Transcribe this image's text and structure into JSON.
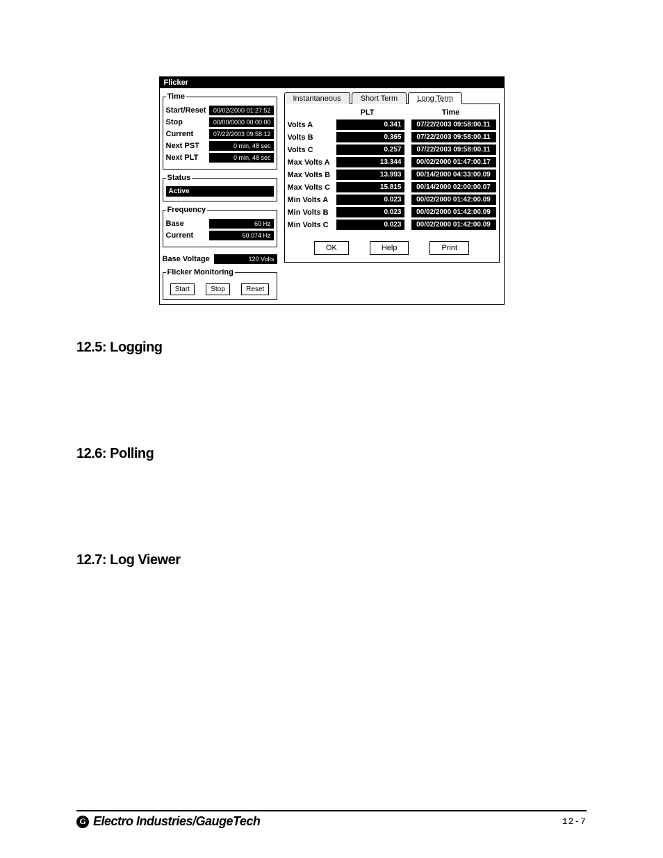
{
  "dialog": {
    "title": "Flicker",
    "time": {
      "legend": "Time",
      "rows": [
        {
          "label": "Start/Reset",
          "value": "00/02/2000 01:27:52"
        },
        {
          "label": "Stop",
          "value": "00/00/0000 00:00:00"
        },
        {
          "label": "Current",
          "value": "07/22/2003 09:58:12"
        },
        {
          "label": "Next PST",
          "value": "0 min, 48 sec"
        },
        {
          "label": "Next PLT",
          "value": "0 min, 48 sec"
        }
      ]
    },
    "status": {
      "legend": "Status",
      "value": "Active"
    },
    "frequency": {
      "legend": "Frequency",
      "rows": [
        {
          "label": "Base",
          "value": "60 Hz"
        },
        {
          "label": "Current",
          "value": "60.074 Hz"
        }
      ]
    },
    "base_voltage": {
      "label": "Base Voltage",
      "value": "120 Volts"
    },
    "flicker_mon": {
      "legend": "Flicker Monitoring",
      "buttons": {
        "start": "Start",
        "stop": "Stop",
        "reset": "Reset"
      }
    },
    "tabs": {
      "instant": "Instantaneous",
      "short": "Short Term",
      "long": "Long Term"
    },
    "headers": {
      "plt": "PLT",
      "time": "Time"
    },
    "data": [
      {
        "label": "Volts A",
        "plt": "0.341",
        "time": "07/22/2003 09:58:00.11"
      },
      {
        "label": "Volts B",
        "plt": "0.365",
        "time": "07/22/2003 09:58:00.11"
      },
      {
        "label": "Volts C",
        "plt": "0.257",
        "time": "07/22/2003 09:58:00.11"
      },
      {
        "label": "Max Volts A",
        "plt": "13.344",
        "time": "00/02/2000 01:47:00.17"
      },
      {
        "label": "Max Volts B",
        "plt": "13.993",
        "time": "00/14/2000 04:33:00.09"
      },
      {
        "label": "Max Volts C",
        "plt": "15.815",
        "time": "00/14/2000 02:00:00.07"
      },
      {
        "label": "Min Volts A",
        "plt": "0.023",
        "time": "00/02/2000 01:42:00.09"
      },
      {
        "label": "Min Volts B",
        "plt": "0.023",
        "time": "00/02/2000 01:42:00.09"
      },
      {
        "label": "Min Volts C",
        "plt": "0.023",
        "time": "00/02/2000 01:42:00.09"
      }
    ],
    "buttons": {
      "ok": "OK",
      "help": "Help",
      "print": "Print"
    }
  },
  "sections": {
    "s1": "12.5: Logging",
    "s2": "12.6: Polling",
    "s3": "12.7: Log Viewer"
  },
  "footer": {
    "logo_glyph": "G",
    "brand": "Electro Industries/GaugeTech",
    "page": "12-7"
  }
}
